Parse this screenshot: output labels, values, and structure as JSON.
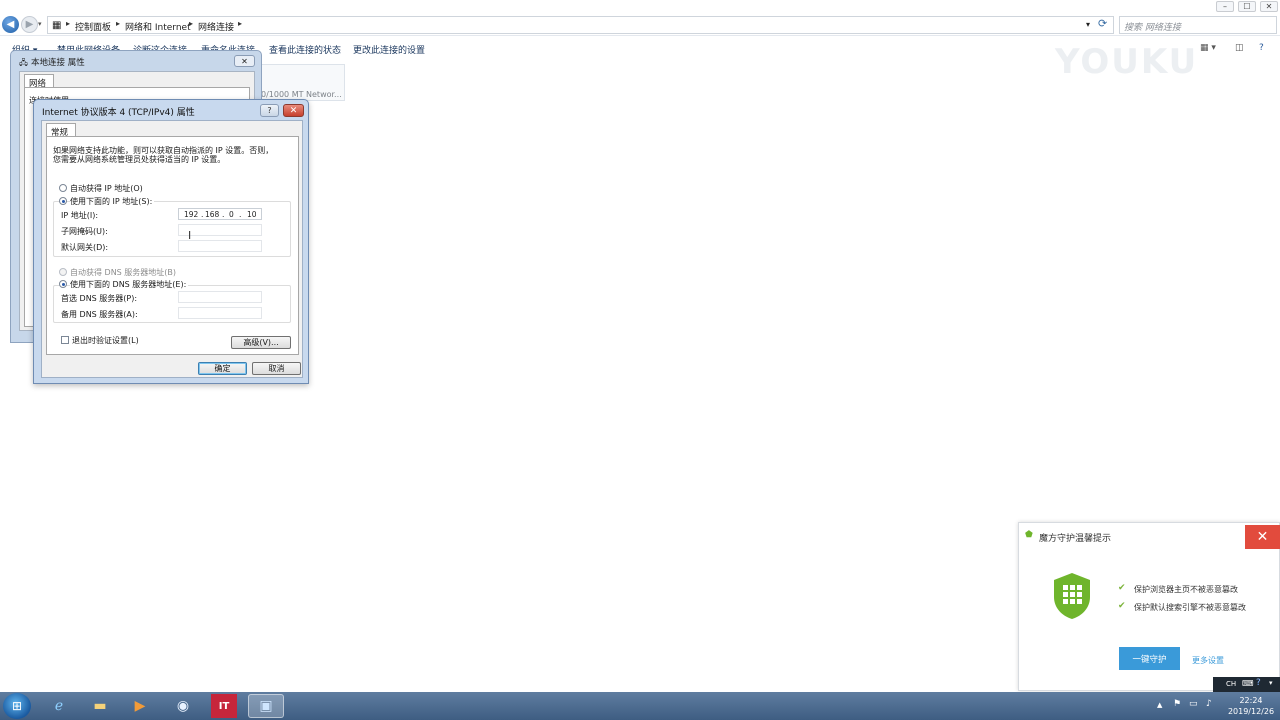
{
  "window": {
    "min": "–",
    "max": "☐",
    "close": "✕"
  },
  "address": {
    "crumbs": [
      "控制面板",
      "网络和 Internet",
      "网络连接"
    ],
    "search_placeholder": "搜索 网络连接"
  },
  "toolbar": {
    "organize": "组织 ▾",
    "disable": "禁用此网络设备",
    "diagnose": "诊断这个连接",
    "rename": "重命名此连接",
    "status": "查看此连接的状态",
    "change": "更改此连接的设置"
  },
  "watermark": "YOUKU",
  "adapter_tile_text": "0/1000 MT Networ...",
  "dialog_local": {
    "title": "本地连接 属性",
    "tab": "网络",
    "connect_using": "连接时使用:",
    "close": "✕"
  },
  "dialog_ipv4": {
    "title": "Internet 协议版本 4 (TCP/IPv4) 属性",
    "help": "?",
    "close": "✕",
    "tab": "常规",
    "intro_line1": "如果网络支持此功能，则可以获取自动指派的 IP 设置。否则，",
    "intro_line2": "您需要从网络系统管理员处获得适当的 IP 设置。",
    "auto_ip": "自动获得 IP 地址(O)",
    "manual_ip": "使用下面的 IP 地址(S):",
    "ip_label": "IP 地址(I):",
    "mask_label": "子网掩码(U):",
    "gateway_label": "默认网关(D):",
    "ip_octets": [
      "192",
      "168",
      "0",
      "10"
    ],
    "auto_dns": "自动获得 DNS 服务器地址(B)",
    "manual_dns": "使用下面的 DNS 服务器地址(E):",
    "dns1_label": "首选 DNS 服务器(P):",
    "dns2_label": "备用 DNS 服务器(A):",
    "validate": "退出时验证设置(L)",
    "advanced": "高级(V)...",
    "ok": "确定",
    "cancel": "取消",
    "dot": "."
  },
  "popup": {
    "title": "魔方守护温馨提示",
    "item1": "保护浏览器主页不被恶意篡改",
    "item2": "保护默认搜索引擎不被恶意篡改",
    "button": "一键守护",
    "more": "更多设置",
    "close": "✕"
  },
  "ime": {
    "lang": "CH"
  },
  "tray": {
    "time": "22:24",
    "date": "2019/12/26"
  },
  "colors": {
    "accent": "#3a9ad9",
    "popup_close": "#e24b3d",
    "shield": "#6fb52c"
  }
}
